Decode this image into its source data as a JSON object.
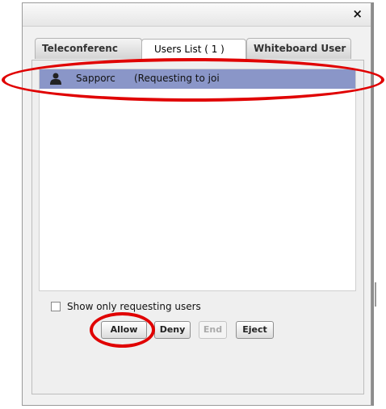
{
  "dialog": {
    "close_glyph": "×"
  },
  "tabs": [
    {
      "label": "Teleconferenc"
    },
    {
      "label": "Users List ( 1 )"
    },
    {
      "label": "Whiteboard User"
    }
  ],
  "users": [
    {
      "name": "Sapporc",
      "status": "(Requesting to joi"
    }
  ],
  "filter": {
    "label": "Show only requesting users",
    "checked": false
  },
  "buttons": {
    "allow": "Allow",
    "deny": "Deny",
    "end": "End",
    "eject": "Eject"
  },
  "colors": {
    "selected_row": "#8a96c8",
    "annotation": "#e00000"
  }
}
